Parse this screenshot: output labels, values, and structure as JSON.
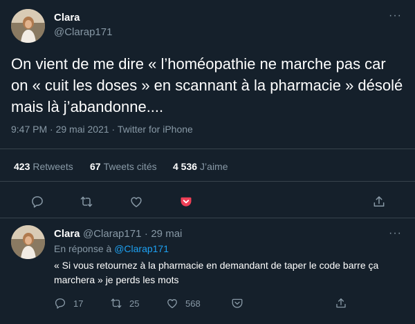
{
  "tweet": {
    "author_name": "Clara",
    "author_handle": "@Clarap171",
    "text": "On vient de me dire « l’homéopathie ne marche pas car on « cuit les doses » en scannant à la pharmacie » désolé mais là j’abandonne....",
    "time": "9:47 PM",
    "date": "29 mai 2021",
    "source": "Twitter for iPhone",
    "separator": "·",
    "stats": {
      "retweets_count": "423",
      "retweets_label": "Retweets",
      "quotes_count": "67",
      "quotes_label": "Tweets cités",
      "likes_count": "4 536",
      "likes_label": "J’aime"
    },
    "more_label": "···",
    "icons": [
      "reply-icon",
      "retweet-icon",
      "like-icon",
      "pocket-icon",
      "share-icon"
    ]
  },
  "reply": {
    "author_name": "Clara",
    "author_handle": "@Clarap171",
    "date": "29 mai",
    "separator": "·",
    "in_reply_prefix": "En réponse à",
    "in_reply_handle": "@Clarap171",
    "text": "« Si vous retournez à la pharmacie en demandant de taper le code barre ça marchera » je perds les mots",
    "reply_count": "17",
    "retweet_count": "25",
    "like_count": "568",
    "more_label": "···"
  },
  "colors": {
    "background": "#15202b",
    "muted": "#8899a6",
    "accent": "#1da1f2",
    "pocket": "#ef3f56",
    "divider": "#38444d"
  }
}
